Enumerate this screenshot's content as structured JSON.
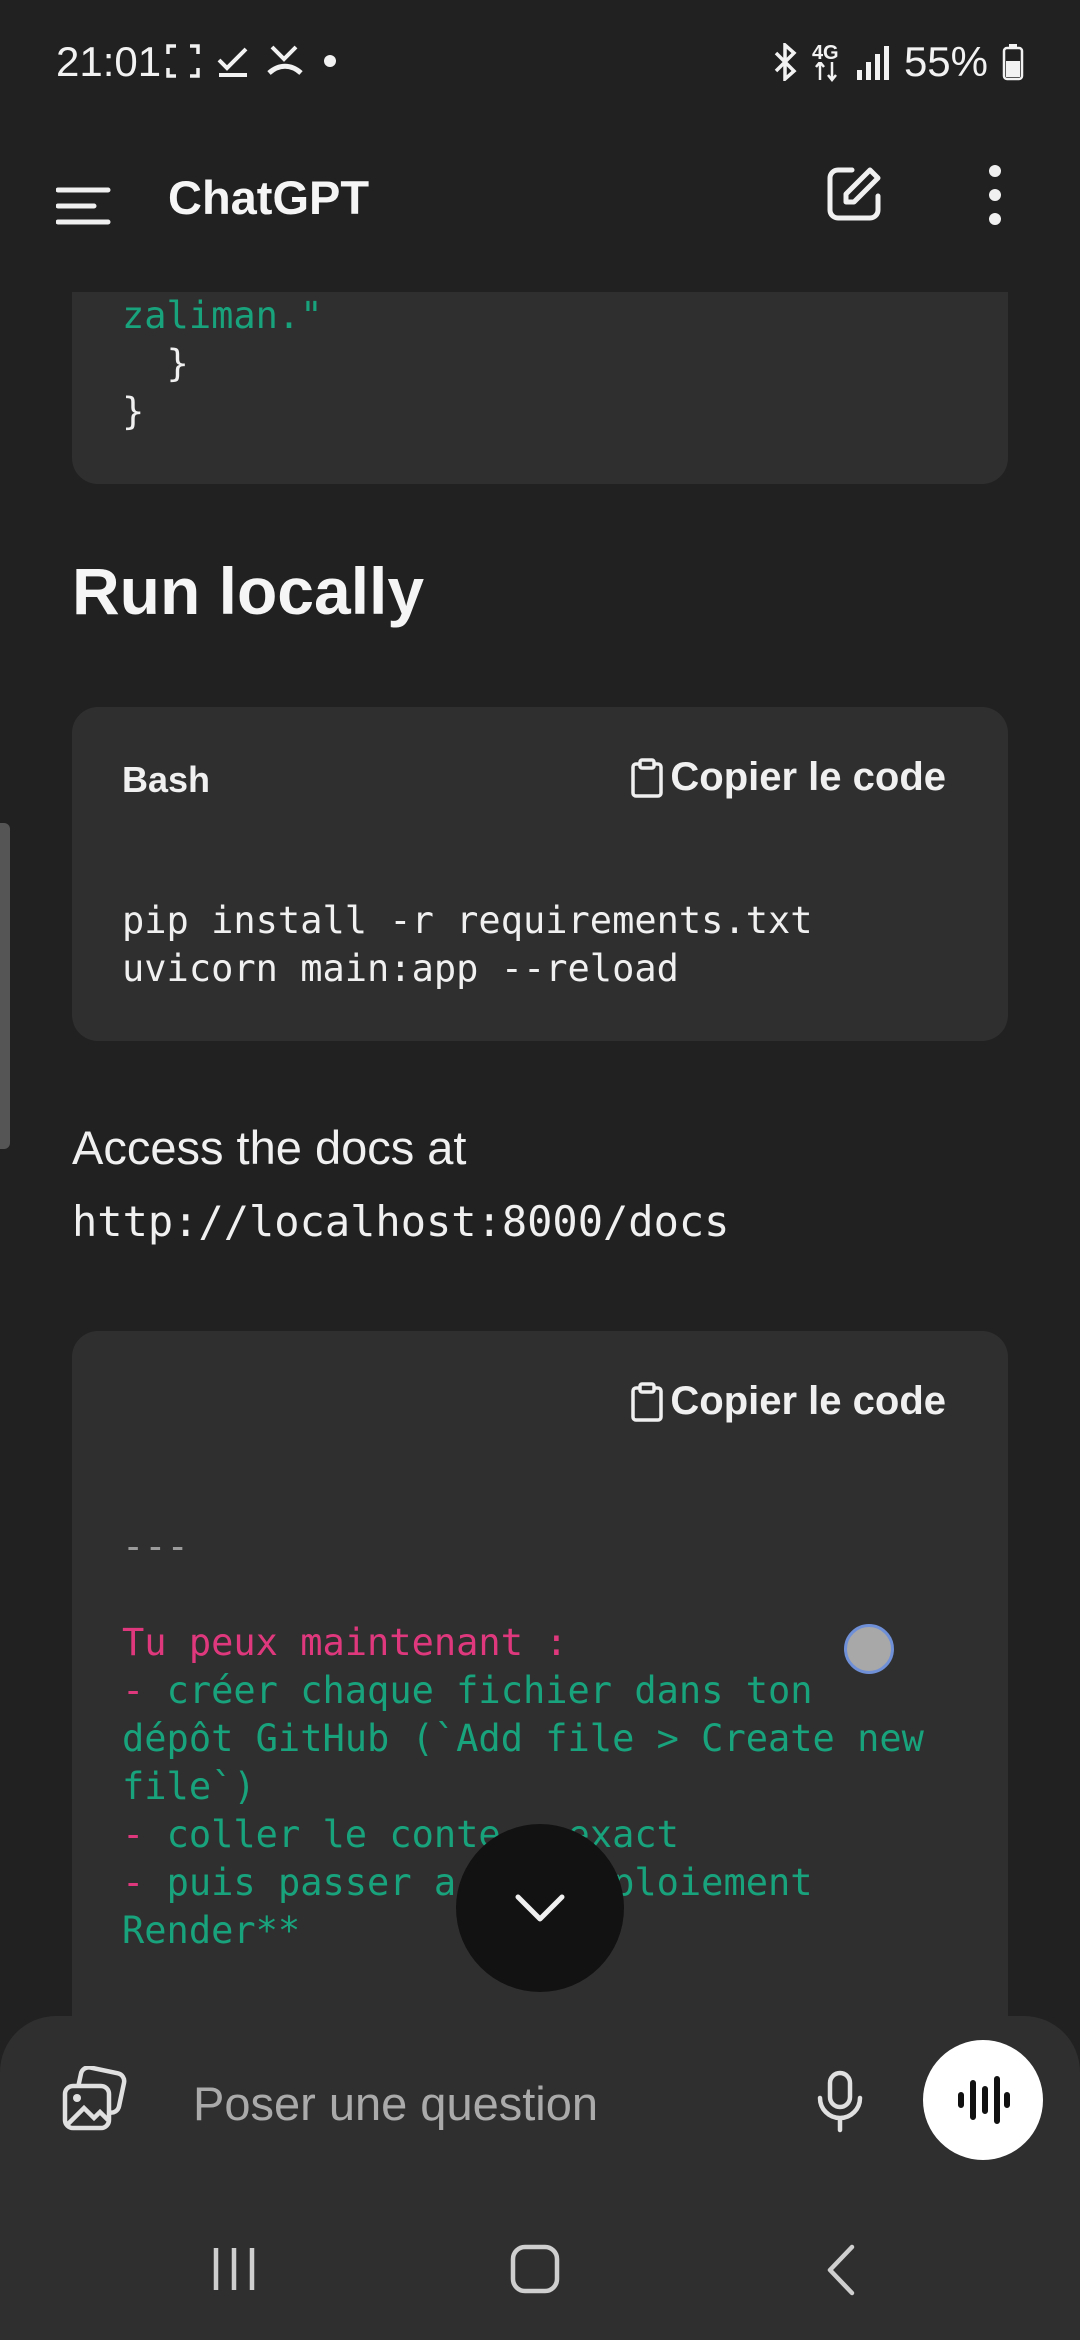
{
  "status_bar": {
    "time": "21:01",
    "network": "4G",
    "battery": "55%",
    "icons": [
      "screenshot-icon",
      "check-icon",
      "missed-call-icon",
      "dot-icon",
      "bluetooth-icon",
      "network-4g-icon",
      "signal-icon",
      "battery-icon"
    ]
  },
  "app_bar": {
    "title": "ChatGPT"
  },
  "code_block_1": {
    "line1": "zaliman.\"",
    "line2": "  }",
    "line3": "}"
  },
  "section_heading": "Run locally",
  "code_block_2": {
    "language": "Bash",
    "copy_label": "Copier le code",
    "lines": [
      "pip install -r requirements.txt",
      "uvicorn main:app --reload"
    ]
  },
  "paragraph": {
    "text": "Access the docs at",
    "url": "http://localhost:8000/docs"
  },
  "code_block_3": {
    "copy_label": "Copier le code",
    "separator": "---",
    "heading_line": "Tu peux maintenant :",
    "bullet1_dash": "- ",
    "bullet1_a": "créer chaque fichier dans ton",
    "bullet1_b": "dépôt GitHub (`Add file > Create new",
    "bullet1_c": "file`)",
    "bullet2_dash": "- ",
    "bullet2": "coller le conte   exact",
    "bullet3_dash": "- ",
    "bullet3": "puis passer a       ploiement",
    "bullet3_b": "Render**"
  },
  "composer": {
    "placeholder": "Poser une question"
  },
  "colors": {
    "background": "#212121",
    "code_bg": "#2f2f2f",
    "code_green": "#19a37d",
    "code_pink": "#e0387d"
  }
}
